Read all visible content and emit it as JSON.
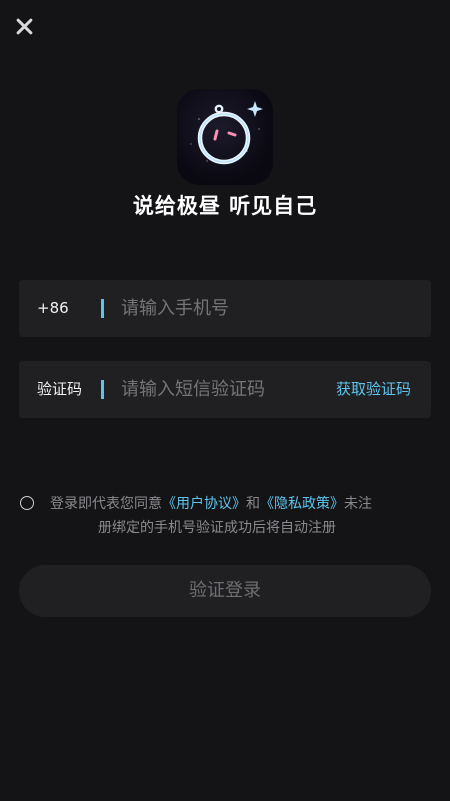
{
  "header": {
    "close_icon": "close-icon"
  },
  "brand": {
    "logo_icon": "app-logo-icon",
    "slogan": "说给极昼 听见自己"
  },
  "phone_field": {
    "prefix": "+86",
    "placeholder": "请输入手机号"
  },
  "code_field": {
    "label": "验证码",
    "placeholder": "请输入短信验证码",
    "get_code_label": "获取验证码"
  },
  "agreement": {
    "text_before": "登录即代表您同意",
    "user_agreement": "《用户协议》",
    "and": "和",
    "privacy_policy": "《隐私政策》",
    "text_after": "未注",
    "line2": "册绑定的手机号验证成功后将自动注册"
  },
  "login_button": {
    "label": "验证登录"
  },
  "colors": {
    "background": "#141416",
    "field_bg": "#202023",
    "accent": "#5ec4ee",
    "placeholder": "#6e6e72"
  }
}
